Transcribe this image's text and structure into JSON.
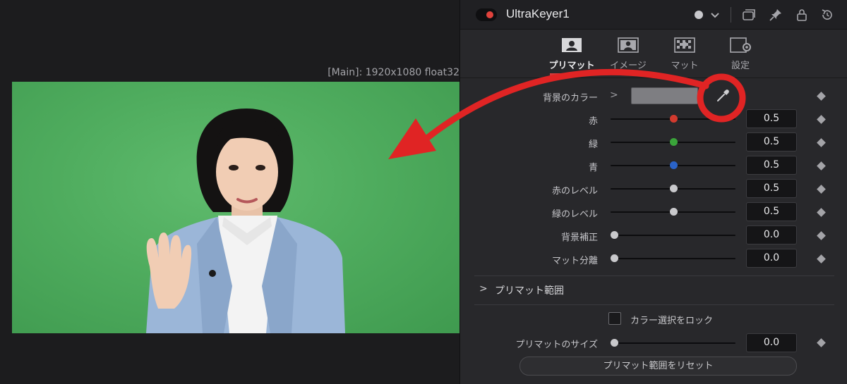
{
  "viewer": {
    "label": "[Main]: 1920x1080 float32",
    "image_desc_colors": {
      "green_screen": "#4fac5e",
      "suit": "#9bb6d8"
    }
  },
  "header": {
    "node_name": "UltraKeyer1",
    "icons": [
      "status-dot-icon",
      "chevron-down-icon",
      "windows-icon",
      "pin-icon",
      "lock-icon",
      "reset-icon"
    ]
  },
  "tabs": [
    {
      "label": "プリマット",
      "icon": "person-frame-icon",
      "active": true
    },
    {
      "label": "イメージ",
      "icon": "image-person-icon",
      "active": false
    },
    {
      "label": "マット",
      "icon": "checker-matte-icon",
      "active": false
    },
    {
      "label": "設定",
      "icon": "settings-gear-icon",
      "active": false
    }
  ],
  "background_color": {
    "label": "背景のカラー",
    "swatch": "#7e7e82"
  },
  "params": [
    {
      "label": "赤",
      "value": "0.5",
      "fraction": 0.5,
      "thumb_color": "#d23a2e"
    },
    {
      "label": "緑",
      "value": "0.5",
      "fraction": 0.5,
      "thumb_color": "#3aa43a"
    },
    {
      "label": "青",
      "value": "0.5",
      "fraction": 0.5,
      "thumb_color": "#2a63c8"
    },
    {
      "label": "赤のレベル",
      "value": "0.5",
      "fraction": 0.5,
      "thumb_color": "#c9c9cc"
    },
    {
      "label": "緑のレベル",
      "value": "0.5",
      "fraction": 0.5,
      "thumb_color": "#c9c9cc"
    },
    {
      "label": "背景補正",
      "value": "0.0",
      "fraction": 0.0,
      "thumb_color": "#c9c9cc"
    },
    {
      "label": "マット分離",
      "value": "0.0",
      "fraction": 0.0,
      "thumb_color": "#c9c9cc"
    }
  ],
  "section": {
    "title": "プリマット範囲"
  },
  "lock": {
    "label": "カラー選択をロック",
    "checked": false
  },
  "prematte_size": {
    "label": "プリマットのサイズ",
    "value": "0.0",
    "fraction": 0.0
  },
  "reset_button": {
    "label": "プリマット範囲をリセット"
  },
  "annotation": {
    "color": "#e02424",
    "shapes": [
      "arrow",
      "circle"
    ]
  }
}
